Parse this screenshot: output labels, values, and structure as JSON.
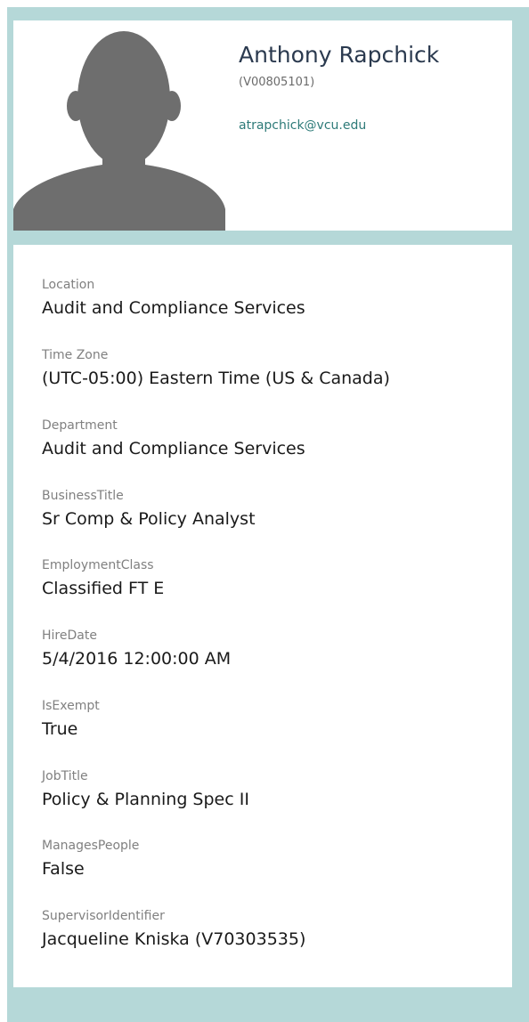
{
  "profile": {
    "name": "Anthony Rapchick",
    "id": "(V00805101)",
    "email": "atrapchick@vcu.edu",
    "avatar_icon": "user-silhouette-icon"
  },
  "details": [
    {
      "key": "location",
      "label": "Location",
      "value": "Audit and Compliance Services"
    },
    {
      "key": "time-zone",
      "label": "Time Zone",
      "value": "(UTC-05:00) Eastern Time (US & Canada)"
    },
    {
      "key": "department",
      "label": "Department",
      "value": "Audit and Compliance Services"
    },
    {
      "key": "business-title",
      "label": "BusinessTitle",
      "value": "Sr Comp & Policy Analyst"
    },
    {
      "key": "employment-class",
      "label": "EmploymentClass",
      "value": "Classified FT E"
    },
    {
      "key": "hire-date",
      "label": "HireDate",
      "value": "5/4/2016 12:00:00 AM"
    },
    {
      "key": "is-exempt",
      "label": "IsExempt",
      "value": "True"
    },
    {
      "key": "job-title",
      "label": "JobTitle",
      "value": "Policy & Planning Spec II"
    },
    {
      "key": "manages-people",
      "label": "ManagesPeople",
      "value": "False"
    },
    {
      "key": "supervisor-identifier",
      "label": "SupervisorIdentifier",
      "value": "Jacqueline Kniska (V70303535)"
    }
  ],
  "colors": {
    "frame": "#b5d8d8",
    "card": "#ffffff",
    "avatar": "#6e6e6e",
    "name": "#2b3a4f",
    "link": "#2d7a78",
    "label": "#808080",
    "value": "#1a1a1a"
  }
}
